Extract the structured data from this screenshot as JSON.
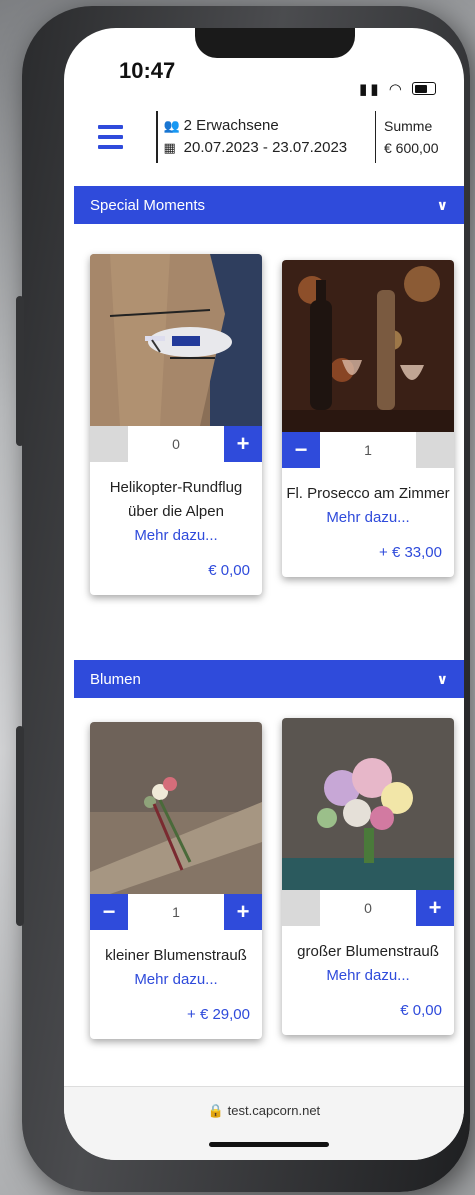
{
  "status": {
    "time": "10:47"
  },
  "header": {
    "guests": "2 Erwachsene",
    "dates": "20.07.2023 - 23.07.2023",
    "sum_label": "Summe",
    "sum_value": "€  600,00"
  },
  "sections": [
    {
      "title": "Special Moments",
      "items": [
        {
          "title": "Helikopter-Rundflug über die Alpen",
          "more": "Mehr dazu...",
          "quantity": "0",
          "price": "€ 0,00"
        },
        {
          "title": "Fl. Prosecco am Zimmer",
          "more": "Mehr dazu...",
          "quantity": "1",
          "price": "+ € 33,00"
        }
      ]
    },
    {
      "title": "Blumen",
      "items": [
        {
          "title": "kleiner Blumenstrauß",
          "more": "Mehr dazu...",
          "quantity": "1",
          "price": "+ € 29,00"
        },
        {
          "title": "großer Blumenstrauß",
          "more": "Mehr dazu...",
          "quantity": "0",
          "price": "€ 0,00"
        }
      ]
    }
  ],
  "url": "test.capcorn.net",
  "colors": {
    "accent": "#2f4bdb"
  }
}
